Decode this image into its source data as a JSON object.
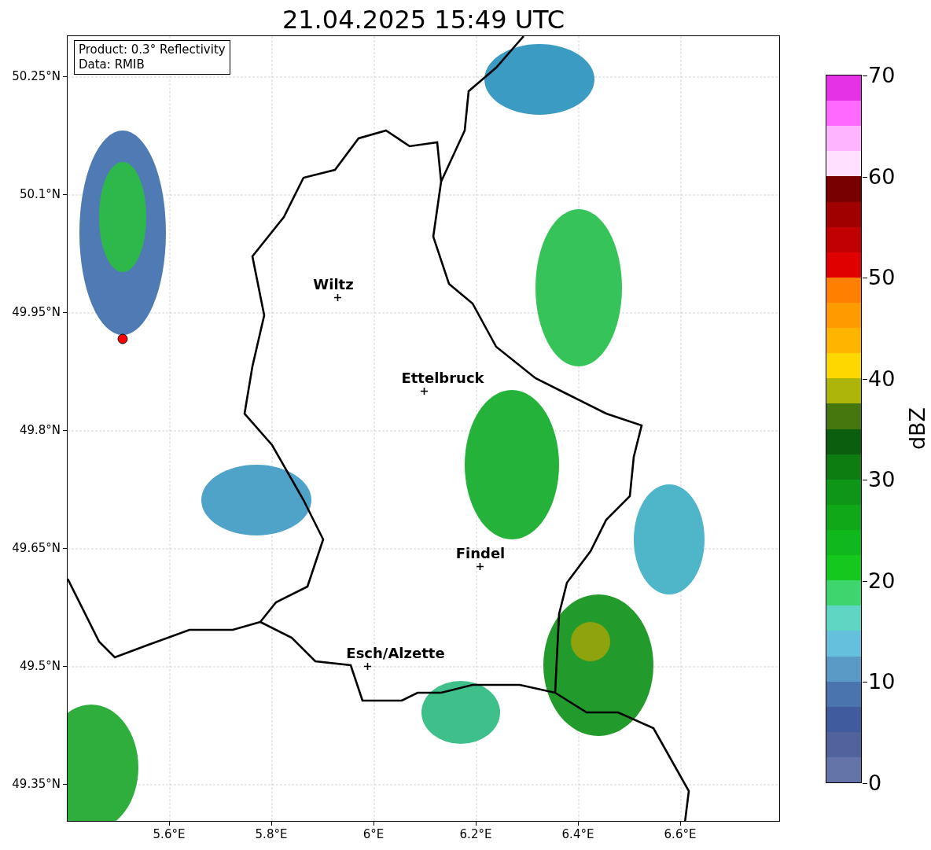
{
  "title": "21.04.2025 15:49 UTC",
  "info_box": {
    "lines": [
      "Product: 0.3° Reflectivity",
      "Data: RMIB"
    ]
  },
  "map": {
    "y_ticks": [
      "50.25°N",
      "50.1°N",
      "49.95°N",
      "49.8°N",
      "49.65°N",
      "49.5°N",
      "49.35°N"
    ],
    "x_ticks": [
      "5.6°E",
      "5.8°E",
      "6°E",
      "6.2°E",
      "6.4°E",
      "6.6°E"
    ],
    "places": [
      {
        "name": "Wiltz"
      },
      {
        "name": "Ettelbruck"
      },
      {
        "name": "Findel"
      },
      {
        "name": "Esch/Alzette"
      }
    ]
  },
  "colorbar": {
    "label": "dBZ",
    "ticks": [
      "70",
      "60",
      "50",
      "40",
      "30",
      "20",
      "10",
      "0"
    ],
    "segments": [
      {
        "color": "#e632e6"
      },
      {
        "color": "#ff69ff"
      },
      {
        "color": "#ffb4ff"
      },
      {
        "color": "#ffe1ff"
      },
      {
        "color": "#780000"
      },
      {
        "color": "#a00000"
      },
      {
        "color": "#c00000"
      },
      {
        "color": "#e00000"
      },
      {
        "color": "#ff7f00"
      },
      {
        "color": "#ff9a00"
      },
      {
        "color": "#ffb400"
      },
      {
        "color": "#ffd700"
      },
      {
        "color": "#adb40a"
      },
      {
        "color": "#46760e"
      },
      {
        "color": "#0a5e0e"
      },
      {
        "color": "#0d7d12"
      },
      {
        "color": "#0e9716"
      },
      {
        "color": "#10a818"
      },
      {
        "color": "#11b81b"
      },
      {
        "color": "#14c81e"
      },
      {
        "color": "#3dd56e"
      },
      {
        "color": "#5fd6c4"
      },
      {
        "color": "#64c0dc"
      },
      {
        "color": "#5a9ac6"
      },
      {
        "color": "#4a74ad"
      },
      {
        "color": "#415b9f"
      },
      {
        "color": "#50639d"
      },
      {
        "color": "#6474a8"
      }
    ]
  }
}
